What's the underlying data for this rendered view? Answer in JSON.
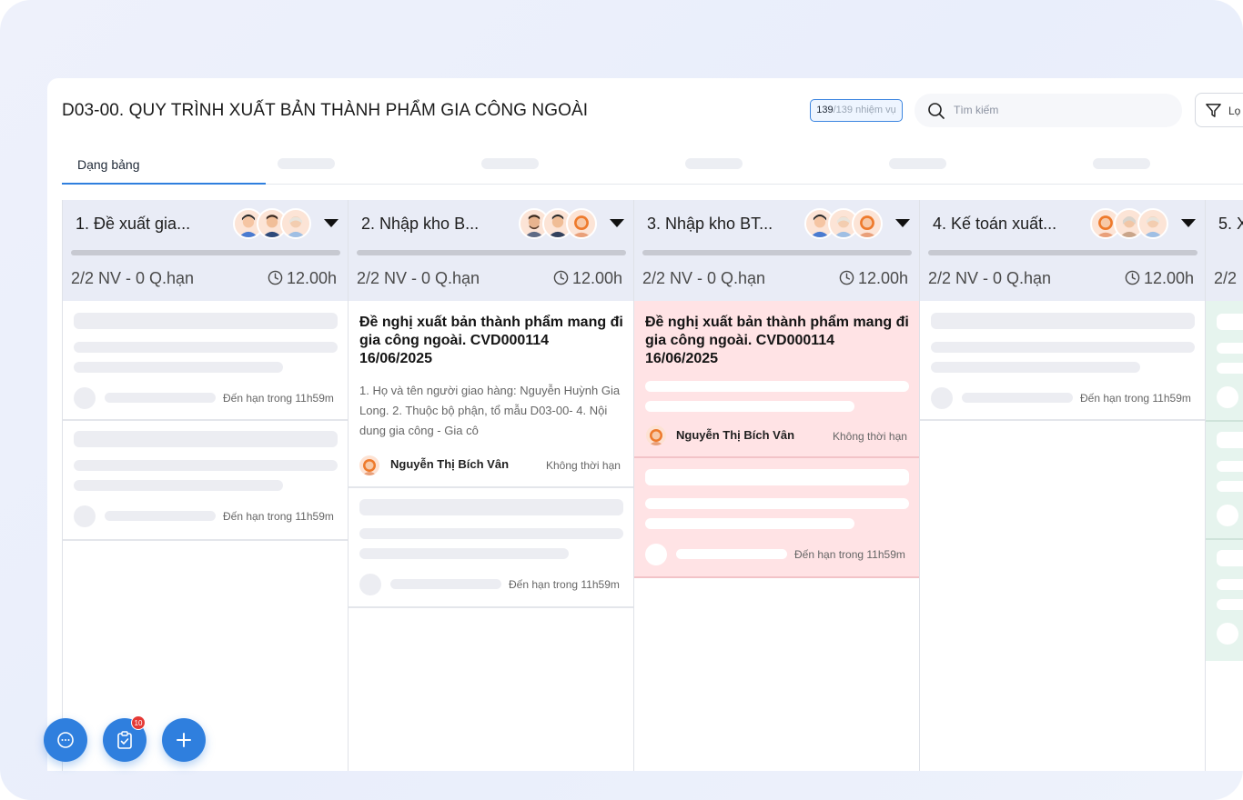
{
  "header": {
    "title": "D03-00. QUY TRÌNH XUẤT BẢN THÀNH PHẨM GIA CÔNG NGOÀI",
    "task_count_done": "139",
    "task_count_rest": "/139 nhiệm vụ",
    "search_placeholder": "Tìm kiếm",
    "filter_label": "Lọ"
  },
  "tabs": {
    "active_label": "Dạng bảng"
  },
  "columns": [
    {
      "title": "1. Đề xuất gia...",
      "meta": "2/2 NV - 0 Q.hạn",
      "hours": "12.00h",
      "cards": [
        {
          "type": "skeleton",
          "due": "Đến hạn trong 11h59m"
        },
        {
          "type": "skeleton",
          "due": "Đến hạn trong 11h59m"
        }
      ]
    },
    {
      "title": "2. Nhập kho B...",
      "meta": "2/2 NV - 0 Q.hạn",
      "hours": "12.00h",
      "cards": [
        {
          "type": "task",
          "title": "Đề nghị xuất bản thành phẩm mang đi gia công ngoài. CVD000114 16/06/2025",
          "desc": "1. Họ và tên người giao hàng: Nguyễn Huỳnh Gia Long. 2. Thuộc bộ phận, tổ mẫu D03-00- 4. Nội dung gia công - Gia cô",
          "assignee": "Nguyễn Thị Bích Vân",
          "deadline": "Không thời hạn"
        },
        {
          "type": "skeleton",
          "due": "Đến hạn trong 11h59m"
        }
      ]
    },
    {
      "title": "3. Nhập kho BT...",
      "meta": "2/2 NV - 0 Q.hạn",
      "hours": "12.00h",
      "cards": [
        {
          "type": "task",
          "title": "Đề nghị xuất bản thành phẩm mang đi gia công ngoài. CVD000114 16/06/2025",
          "assignee": "Nguyễn Thị Bích Vân",
          "deadline": "Không thời hạn"
        },
        {
          "type": "skeleton",
          "due": "Đến hạn trong 11h59m"
        }
      ]
    },
    {
      "title": "4. Kế toán xuất...",
      "meta": "2/2 NV - 0 Q.hạn",
      "hours": "12.00h",
      "cards": [
        {
          "type": "skeleton",
          "due": "Đến hạn trong 11h59m"
        }
      ]
    },
    {
      "title": "5. X",
      "meta": "2/2"
    }
  ],
  "fabs": {
    "tasks_badge": "10"
  },
  "colors": {
    "accent": "#2f7fde",
    "header_bg": "#e9ecf6",
    "overdue_card": "#ffe3e5"
  }
}
